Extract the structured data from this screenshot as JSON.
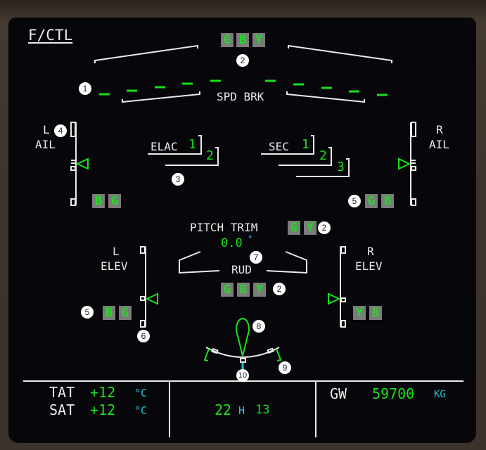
{
  "page": {
    "title": "F/CTL"
  },
  "speed_brake": {
    "label": "SPD BRK",
    "hydraulics": [
      "G",
      "B",
      "Y"
    ],
    "spoiler_count_per_side": 5,
    "status": "retracted"
  },
  "computers": {
    "elac": {
      "label": "ELAC",
      "units": [
        "1",
        "2"
      ]
    },
    "sec": {
      "label": "SEC",
      "units": [
        "1",
        "2",
        "3"
      ]
    }
  },
  "ailerons": {
    "left": {
      "label_line1": "L",
      "label_line2": "AIL",
      "hydraulics": [
        "B",
        "G"
      ]
    },
    "right": {
      "label_line1": "R",
      "label_line2": "AIL",
      "hydraulics": [
        "G",
        "B"
      ]
    }
  },
  "pitch_trim": {
    "label": "PITCH TRIM",
    "value": "0.0",
    "unit": "°",
    "hydraulics": [
      "G",
      "Y"
    ]
  },
  "rudder": {
    "label": "RUD",
    "hydraulics": [
      "G",
      "B",
      "Y"
    ]
  },
  "elevators": {
    "left": {
      "label_line1": "L",
      "label_line2": "ELEV",
      "hydraulics": [
        "B",
        "G"
      ]
    },
    "right": {
      "label_line1": "R",
      "label_line2": "ELEV",
      "hydraulics": [
        "Y",
        "B"
      ]
    }
  },
  "callouts": [
    "1",
    "2",
    "2",
    "2",
    "3",
    "4",
    "5",
    "5",
    "6",
    "7",
    "8",
    "9",
    "10"
  ],
  "footer": {
    "tat": {
      "label": "TAT",
      "value": "+12",
      "unit": "°C"
    },
    "sat": {
      "label": "SAT",
      "value": "+12",
      "unit": "°C"
    },
    "time": {
      "hours": "22",
      "sep": "H",
      "minutes": "13"
    },
    "gw": {
      "label": "GW",
      "value": "59700",
      "unit": "KG"
    }
  },
  "colors": {
    "green": "#19e01c",
    "white": "#eaeaea",
    "cyan": "#22c7d6",
    "hyd_box": "#7b7b7b",
    "background": "#07060a"
  }
}
